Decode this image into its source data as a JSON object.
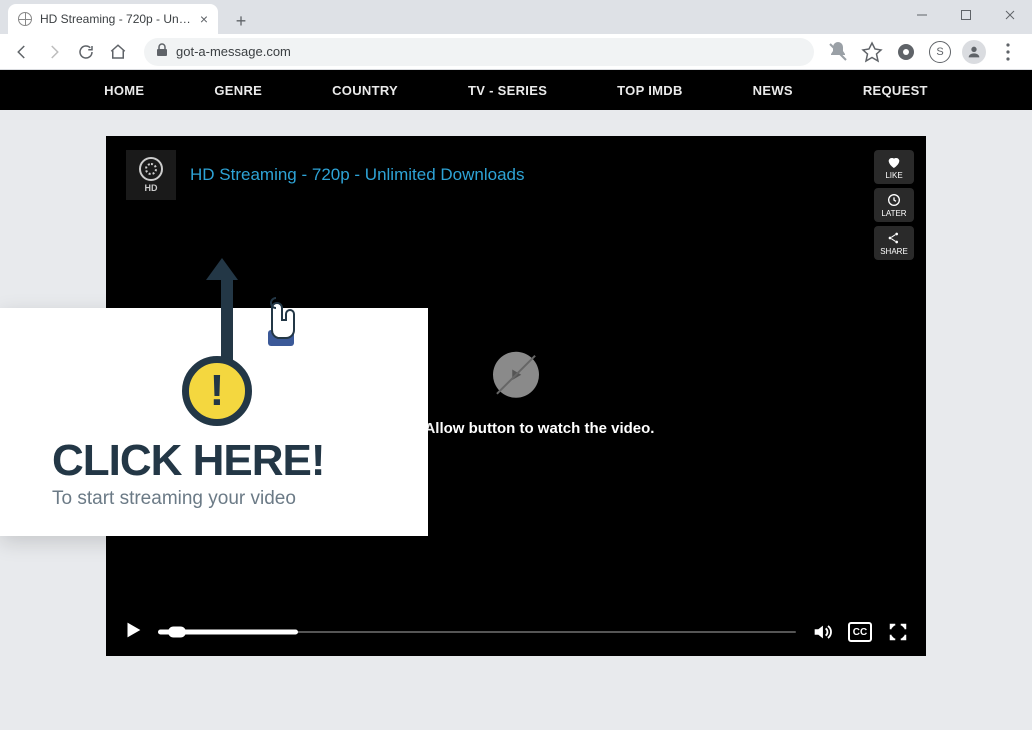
{
  "browser": {
    "tab_title": "HD Streaming - 720p - Unlimite…",
    "url": "got-a-message.com"
  },
  "nav": {
    "items": [
      "HOME",
      "GENRE",
      "COUNTRY",
      "TV - SERIES",
      "TOP IMDB",
      "NEWS",
      "REQUEST"
    ]
  },
  "player": {
    "title": "HD Streaming - 720p - Unlimited Downloads",
    "hd_label": "HD",
    "side_buttons": [
      {
        "key": "like",
        "label": "LIKE"
      },
      {
        "key": "later",
        "label": "LATER"
      },
      {
        "key": "share",
        "label": "SHARE"
      }
    ],
    "center_message": "ck the Allow button to watch the video.",
    "cc_label": "CC"
  },
  "overlay": {
    "heading": "CLICK HERE!",
    "subheading": "To start streaming your video"
  }
}
